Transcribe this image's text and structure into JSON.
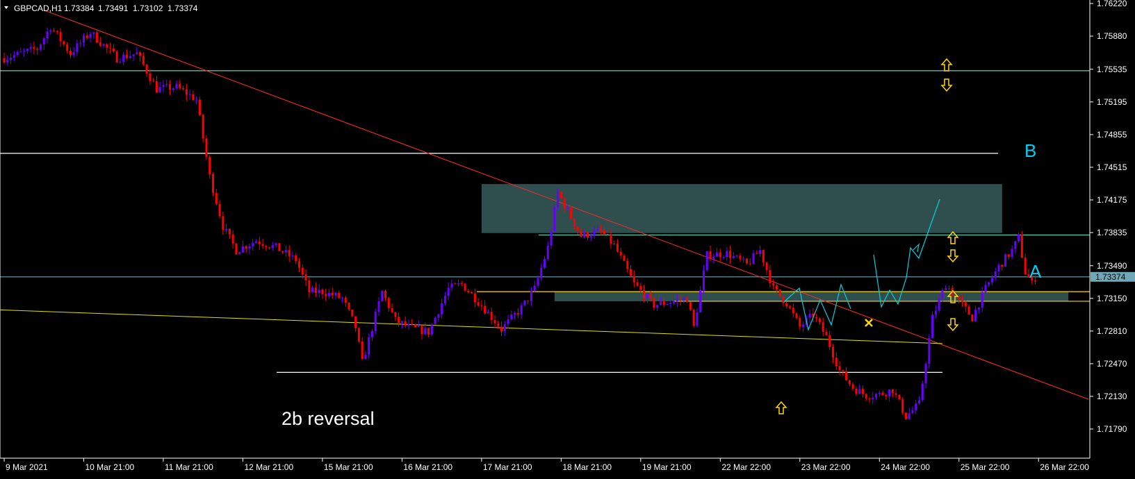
{
  "chart_data": {
    "type": "candlestick",
    "symbol_header": "GBPCAD,H1",
    "ohlc": [
      "1.73384",
      "1.73491",
      "1.73102",
      "1.73374"
    ],
    "current_price": "1.73374",
    "y_ticks": [
      "1.76220",
      "1.75880",
      "1.75535",
      "1.75195",
      "1.74855",
      "1.74515",
      "1.74175",
      "1.73835",
      "1.73490",
      "1.73150",
      "1.72810",
      "1.72470",
      "1.72130",
      "1.71790"
    ],
    "y_tick_values": [
      1.7622,
      1.7588,
      1.75535,
      1.75195,
      1.74855,
      1.74515,
      1.74175,
      1.73835,
      1.7349,
      1.7315,
      1.7281,
      1.7247,
      1.7213,
      1.7179
    ],
    "ylim": [
      1.7172,
      1.7623
    ],
    "x_ticks": [
      "9 Mar 2021",
      "10 Mar 21:00",
      "11 Mar 21:00",
      "12 Mar 21:00",
      "15 Mar 21:00",
      "16 Mar 21:00",
      "17 Mar 21:00",
      "18 Mar 21:00",
      "19 Mar 21:00",
      "22 Mar 22:00",
      "23 Mar 22:00",
      "24 Mar 22:00",
      "25 Mar 22:00",
      "26 Mar 22:00"
    ],
    "x_tick_bars": [
      0,
      24,
      48,
      72,
      96,
      120,
      144,
      168,
      192,
      216,
      240,
      264,
      288,
      312
    ],
    "bar_count": 312,
    "close_path": [
      [
        0,
        1.7565
      ],
      [
        10,
        1.7575
      ],
      [
        14,
        1.7598
      ],
      [
        20,
        1.757
      ],
      [
        26,
        1.7592
      ],
      [
        34,
        1.7565
      ],
      [
        40,
        1.757
      ],
      [
        46,
        1.7533
      ],
      [
        52,
        1.7535
      ],
      [
        58,
        1.7522
      ],
      [
        62,
        1.7442
      ],
      [
        66,
        1.739
      ],
      [
        70,
        1.7365
      ],
      [
        76,
        1.7375
      ],
      [
        82,
        1.7368
      ],
      [
        88,
        1.7355
      ],
      [
        92,
        1.7322
      ],
      [
        96,
        1.7322
      ],
      [
        102,
        1.7315
      ],
      [
        106,
        1.7285
      ],
      [
        108,
        1.7248
      ],
      [
        110,
        1.7272
      ],
      [
        114,
        1.7322
      ],
      [
        118,
        1.7292
      ],
      [
        122,
        1.7285
      ],
      [
        128,
        1.728
      ],
      [
        134,
        1.7325
      ],
      [
        138,
        1.733
      ],
      [
        144,
        1.7308
      ],
      [
        150,
        1.7283
      ],
      [
        156,
        1.7305
      ],
      [
        160,
        1.7325
      ],
      [
        164,
        1.7368
      ],
      [
        167,
        1.7425
      ],
      [
        169,
        1.7412
      ],
      [
        174,
        1.738
      ],
      [
        180,
        1.7385
      ],
      [
        184,
        1.737
      ],
      [
        190,
        1.733
      ],
      [
        196,
        1.7308
      ],
      [
        202,
        1.7312
      ],
      [
        206,
        1.7315
      ],
      [
        208,
        1.7285
      ],
      [
        212,
        1.736
      ],
      [
        218,
        1.7362
      ],
      [
        224,
        1.735
      ],
      [
        228,
        1.7365
      ],
      [
        232,
        1.7325
      ],
      [
        236,
        1.731
      ],
      [
        240,
        1.7285
      ],
      [
        244,
        1.7298
      ],
      [
        248,
        1.7275
      ],
      [
        252,
        1.724
      ],
      [
        256,
        1.7222
      ],
      [
        260,
        1.7214
      ],
      [
        264,
        1.7215
      ],
      [
        268,
        1.722
      ],
      [
        272,
        1.7192
      ],
      [
        276,
        1.7205
      ],
      [
        280,
        1.7295
      ],
      [
        284,
        1.733
      ],
      [
        288,
        1.7312
      ],
      [
        292,
        1.7295
      ],
      [
        296,
        1.7325
      ],
      [
        300,
        1.7348
      ],
      [
        304,
        1.7365
      ],
      [
        306,
        1.7378
      ],
      [
        308,
        1.7342
      ],
      [
        310,
        1.733
      ],
      [
        311,
        1.73374
      ]
    ],
    "horizontal_levels": [
      {
        "label": "resistance-upper",
        "price": 1.7552,
        "color": "#5fd0b4"
      },
      {
        "label": "level-B",
        "price": 1.7466,
        "color": "#ffffff"
      },
      {
        "label": "level-A-upper",
        "price": 1.7381,
        "color": "#5fd0b4"
      },
      {
        "label": "current-price-line",
        "price": 1.73374,
        "color": "#6f9fb4"
      },
      {
        "label": "level-A-lower-1",
        "price": 1.7322,
        "color": "#ffd700"
      },
      {
        "label": "level-A-lower-2",
        "price": 1.7312,
        "color": "#ffd700"
      },
      {
        "label": "support-low",
        "price": 1.7238,
        "color": "#ffffff"
      }
    ],
    "zones": [
      {
        "name": "supply-zone",
        "from_bar": 144,
        "to_bar": 301,
        "price_top": 1.7434,
        "price_bottom": 1.7383,
        "color": "#2f4f4f"
      },
      {
        "name": "demand-zone",
        "from_bar": 166,
        "to_bar": 321,
        "price_top": 1.7322,
        "price_bottom": 1.7312,
        "color": "#2f4f4f"
      }
    ],
    "trendlines": [
      {
        "name": "red-downtrend",
        "color": "#ff2a2a"
      },
      {
        "name": "yellow-trend",
        "color": "#e0e000"
      }
    ],
    "annotations": {
      "label_a": "A",
      "label_b": "B",
      "reversal_text": "2b reversal"
    },
    "colors": {
      "background": "#000000",
      "bull": "#6a00ff",
      "bear": "#ff0000",
      "axis": "#ffffff",
      "projection": "#00d0e0",
      "arrows": "#ffd700",
      "label_ab": "#00d0f0",
      "price_tag": "#6fa8b8"
    }
  }
}
